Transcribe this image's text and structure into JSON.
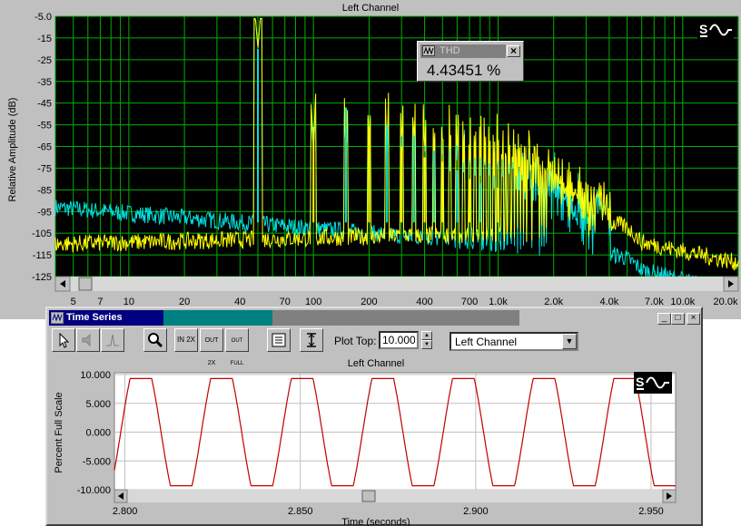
{
  "spectrum": {
    "title": "Left Channel",
    "ylabel": "Relative Amplitude (dB)",
    "y_ticks": [
      "-5.0",
      "-15",
      "-25",
      "-35",
      "-45",
      "-55",
      "-65",
      "-75",
      "-85",
      "-95",
      "-105",
      "-115",
      "-125"
    ],
    "x_ticks": [
      "5",
      "7",
      "10",
      "20",
      "40",
      "70",
      "100",
      "200",
      "400",
      "700",
      "1.0k",
      "2.0k",
      "4.0k",
      "7.0k",
      "10.0k",
      "20.0k"
    ],
    "bg_color": "#000000",
    "grid_color": "#00b000",
    "trace_colors": [
      "#00e0e0",
      "#ffff00"
    ],
    "logo_icon": "spectraplus-logo-icon"
  },
  "thd_box": {
    "title": "THD",
    "close": "×",
    "value": "4.43451 %"
  },
  "time_series": {
    "window_title": "Time Series",
    "window_buttons": [
      "_",
      "□",
      "×"
    ],
    "toolbar": {
      "zoom_in_label": "IN 2X",
      "zoom_out_label": "OUT 2X",
      "zoom_full_label": "OUT FULL",
      "plot_top_label": "Plot Top:",
      "plot_top_value": "10.000",
      "channel_value": "Left Channel"
    },
    "plot_title": "Left Channel",
    "ylabel": "Percent Full Scale",
    "xlabel": "Time (seconds)",
    "y_ticks": [
      "10.000",
      "5.000",
      "0.000",
      "-5.000",
      "-10.000"
    ],
    "x_ticks": [
      "2.800",
      "2.850",
      "2.900",
      "2.950"
    ],
    "trace_color": "#c00000"
  },
  "chart_data": [
    {
      "type": "line",
      "title": "Left Channel",
      "xlabel": "",
      "ylabel": "Relative Amplitude (dB)",
      "x_scale": "log",
      "xlim": [
        4,
        20000
      ],
      "ylim": [
        -125,
        -5
      ],
      "grid": true,
      "peaks": {
        "x": [
          50,
          100,
          150,
          200,
          250,
          300,
          350,
          400,
          450,
          500,
          600,
          700,
          800,
          1000
        ],
        "y": [
          -20,
          -56,
          -47,
          -58,
          -55,
          -65,
          -60,
          -70,
          -67,
          -72,
          -76,
          -80,
          -82,
          -84
        ]
      }
    },
    {
      "type": "line",
      "title": "Left Channel",
      "xlabel": "Time (seconds)",
      "ylabel": "Percent Full Scale",
      "xlim": [
        2.797,
        2.957
      ],
      "ylim": [
        -10,
        10
      ],
      "grid": true,
      "series": [
        {
          "frequency_hz": 43.5,
          "amplitude": 9.3,
          "clipped": true
        }
      ]
    }
  ]
}
